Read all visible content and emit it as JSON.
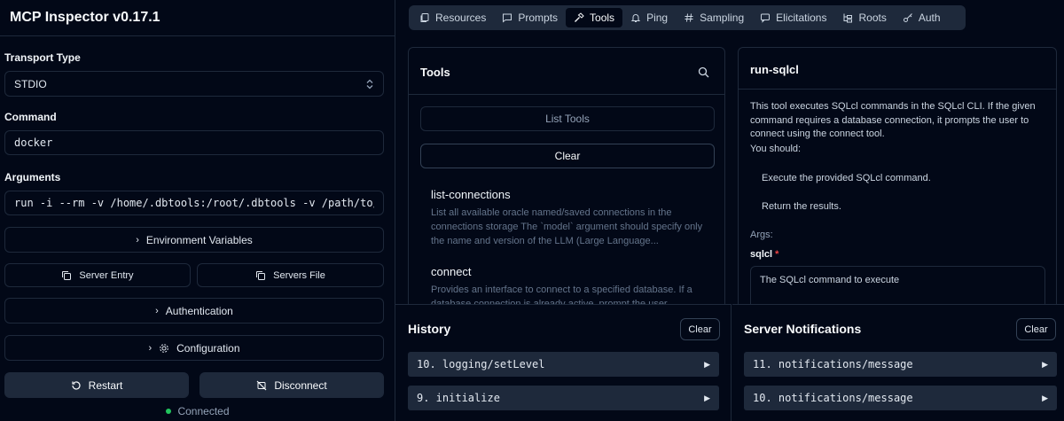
{
  "sidebar": {
    "title": "MCP Inspector v0.17.1",
    "transport_label": "Transport Type",
    "transport_value": "STDIO",
    "command_label": "Command",
    "command_value": "docker",
    "arguments_label": "Arguments",
    "arguments_value": "run -i --rm -v /home/.dbtools:/root/.dbtools -v /path/to/sandbox",
    "env_vars_label": "Environment Variables",
    "server_entry_label": "Server Entry",
    "servers_file_label": "Servers File",
    "authentication_label": "Authentication",
    "configuration_label": "Configuration",
    "restart_label": "Restart",
    "disconnect_label": "Disconnect",
    "status_text": "Connected"
  },
  "tabs": [
    {
      "label": "Resources",
      "icon": "files-icon"
    },
    {
      "label": "Prompts",
      "icon": "message-icon"
    },
    {
      "label": "Tools",
      "icon": "hammer-icon",
      "active": true
    },
    {
      "label": "Ping",
      "icon": "bell-icon"
    },
    {
      "label": "Sampling",
      "icon": "hash-icon"
    },
    {
      "label": "Elicitations",
      "icon": "message-square-icon"
    },
    {
      "label": "Roots",
      "icon": "folder-tree-icon"
    },
    {
      "label": "Auth",
      "icon": "key-icon"
    }
  ],
  "tools_panel": {
    "title": "Tools",
    "list_tools_label": "List Tools",
    "clear_label": "Clear",
    "items": [
      {
        "name": "list-connections",
        "description": "List all available oracle named/saved connections in the connections storage The `model` argument should specify only the name and version of the LLM (Large Language..."
      },
      {
        "name": "connect",
        "description": "Provides an interface to connect to a specified database. If a database connection is already active, prompt the user"
      }
    ]
  },
  "detail_panel": {
    "title": "run-sqlcl",
    "description": "This tool executes SQLcl commands in the SQLcl CLI. If the given command requires a database connection, it prompts the user to connect using the connect tool.",
    "you_should": "You should:",
    "step1": "Execute the provided SQLcl command.",
    "step2": "Return the results.",
    "args_label": "Args:",
    "param_name": "sqlcl",
    "param_required": "*",
    "param_placeholder": "The SQLcl command to execute"
  },
  "history": {
    "title": "History",
    "clear_label": "Clear",
    "entries": [
      "10. logging/setLevel",
      "9. initialize"
    ]
  },
  "notifications": {
    "title": "Server Notifications",
    "clear_label": "Clear",
    "entries": [
      "11. notifications/message",
      "10. notifications/message"
    ]
  },
  "colors": {
    "background": "#020817",
    "border": "#1e293b",
    "status_green": "#22c55e",
    "required_red": "#ef4444"
  }
}
